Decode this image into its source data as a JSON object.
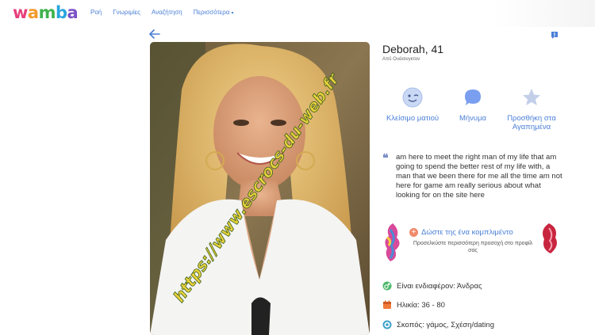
{
  "brand": {
    "logo_letters": [
      "w",
      "a",
      "m",
      "b",
      "a"
    ],
    "logo_colors": [
      "#e7407c",
      "#f39a2c",
      "#3fb24c",
      "#2aa6de",
      "#7b52c6"
    ]
  },
  "nav": {
    "items": [
      {
        "label": "Ροή"
      },
      {
        "label": "Γνωριμίες"
      },
      {
        "label": "Αναζήτηση"
      },
      {
        "label": "Περισσότερα",
        "caret": "▾"
      }
    ]
  },
  "profile": {
    "name": "Deborah, 41",
    "location": "Από Ουάσινγκτον",
    "photo_watermark": "https://www.escrocs-du-web.fr"
  },
  "actions": [
    {
      "label": "Κλείσιμο ματιού",
      "icon": "wink-smiley-icon"
    },
    {
      "label": "Μήνυμα",
      "icon": "chat-bubble-icon"
    },
    {
      "label": "Προσθήκη στα Αγαπημένα",
      "icon": "star-icon"
    }
  ],
  "bio": {
    "text": "am here to meet the right man of my life that am going to spend the better rest of my life with, a man that we been there for me all the time am not here for game am really serious about what looking for on the site here"
  },
  "compliment": {
    "button_label": "Δώστε της ένα κομπλιμέντο",
    "hint": "Προσελκύστε περισσότερη προσοχή στο προφίλ σας"
  },
  "facts": [
    {
      "text": "Είναι ενδιαφέρον: Άνδρας",
      "icon": "gender-icon",
      "color": "#4cb86a"
    },
    {
      "text": "Ηλικία: 36 - 80",
      "icon": "calendar-icon",
      "color": "#f07a3a"
    },
    {
      "text": "Σκοπός: γάμος, Σχέση/dating",
      "icon": "target-icon",
      "color": "#3fa1c8"
    }
  ],
  "colors": {
    "accent": "#4a7fd6",
    "text": "#333333"
  }
}
